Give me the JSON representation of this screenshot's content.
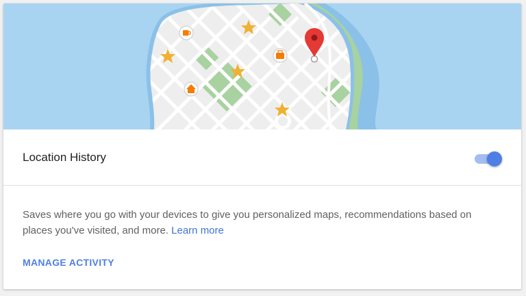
{
  "colors": {
    "water": "#a8d4f1",
    "water_shore": "#8bc1e8",
    "land": "#eeeeee",
    "park": "#a8d2a0",
    "road": "#ffffff",
    "star": "#f0b132",
    "pin": "#e53935",
    "poi": "#f57c00",
    "accent": "#4f7fe4",
    "link": "#3f73d6"
  },
  "map": {
    "icons": [
      "coffee-icon",
      "briefcase-icon",
      "home-icon",
      "star-icon",
      "map-pin-icon"
    ]
  },
  "setting": {
    "title": "Location History",
    "toggle_on": true
  },
  "description": {
    "text": "Saves where you go with your devices to give you personalized maps, recommendations based on places you've visited, and more.",
    "link": "Learn more"
  },
  "actions": {
    "manage": "MANAGE ACTIVITY"
  }
}
